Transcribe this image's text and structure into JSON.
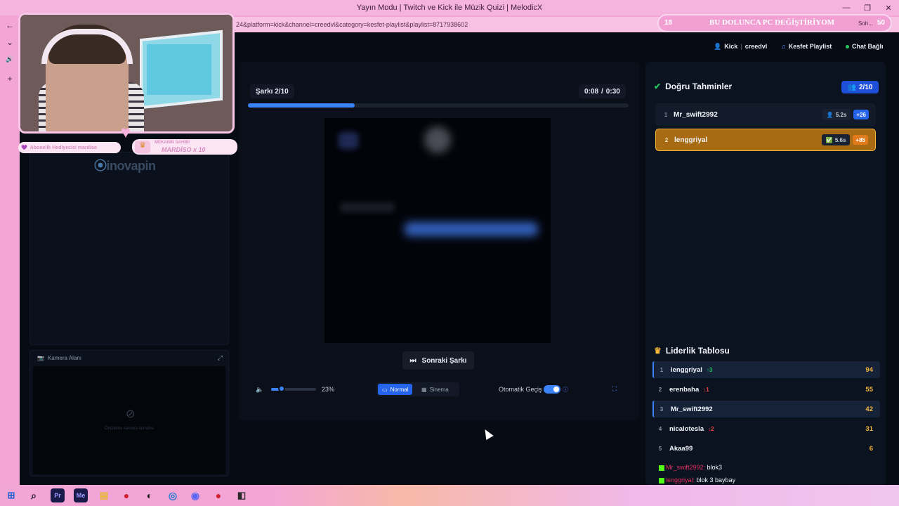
{
  "browser": {
    "window_title": "Yayın Modu | Twitch ve Kick ile Müzik Quizi | MelodicX",
    "url": "24&platform=kick&channel=creedvl&category=kesfet-playlist&playlist=8717938602",
    "minimize": "—",
    "restore": "❐",
    "close": "✕"
  },
  "nav_icons": [
    "←",
    "⌄",
    "🔊",
    "+"
  ],
  "top_pills": {
    "platform": "Kick",
    "channel": "creedvl",
    "playlist": "Kesfet Playlist",
    "chat_status": "Chat Bağlı"
  },
  "player": {
    "song_counter": "Şarkı 2/10",
    "time_current": "0:08",
    "time_separator": "/",
    "time_total": "0:30",
    "progress_fraction": 0.28,
    "next_button": "Sonraki Şarkı",
    "volume_percent": "23%",
    "volume_fraction": 0.23,
    "mode_normal": "Normal",
    "mode_cinema": "Sinema",
    "auto_advance_label": "Otomatik Geçiş",
    "auto_advance_on": true
  },
  "camera": {
    "title": "Kamera Alanı",
    "placeholder": "Önizleme kamera konumu"
  },
  "correct_guesses": {
    "title": "Doğru Tahminler",
    "count": "2/10",
    "items": [
      {
        "rank": "1",
        "name": "Mr_swift2992",
        "time": "5.2s",
        "points": "+26"
      },
      {
        "rank": "2",
        "name": "lenggriyal",
        "time": "5.6s",
        "points": "+85"
      }
    ]
  },
  "leaderboard": {
    "title": "Liderlik Tablosu",
    "rows": [
      {
        "rank": "1",
        "name": "lenggriyal",
        "trend": "↑3",
        "trend_dir": "up",
        "score": "94"
      },
      {
        "rank": "2",
        "name": "erenbaha",
        "trend": "↓1",
        "trend_dir": "down",
        "score": "55"
      },
      {
        "rank": "3",
        "name": "Mr_swift2992",
        "trend": "",
        "trend_dir": "",
        "score": "42"
      },
      {
        "rank": "4",
        "name": "nicalotesla",
        "trend": "↓2",
        "trend_dir": "down",
        "score": "31"
      },
      {
        "rank": "5",
        "name": "Akaa99",
        "trend": "",
        "trend_dir": "",
        "score": "6"
      }
    ]
  },
  "chat": [
    {
      "user": "Mr_swift2992:",
      "text": " blok3"
    },
    {
      "user": "lenggriyal:",
      "text": " blok 3 baybay"
    }
  ],
  "overlay": {
    "subscriber_gift": "Abonelik Hediyecisi mardiso",
    "owner_label": "MEKANIN SAHİBİ",
    "owner_name": "MARDİSO x 10",
    "sponsor": "inovapin",
    "goal_count": "18",
    "goal_text": "BU DOLUNCA PC DEĞİŞTİRİYOM",
    "goal_sub": "Soh...",
    "goal_target": "50"
  },
  "taskbar_icons": [
    "⊞",
    "⌕",
    "Pr",
    "Me",
    "▤",
    "●",
    "◐",
    "◎",
    "◉",
    "●",
    "◧"
  ],
  "colors": {
    "accent": "#3b82f6",
    "gold_row": "#a86b14",
    "score": "#f5b83c",
    "trend_up": "#22c55e",
    "trend_down": "#ef4444",
    "kick_green": "#53fc18",
    "chat_ok": "#22c55e"
  }
}
